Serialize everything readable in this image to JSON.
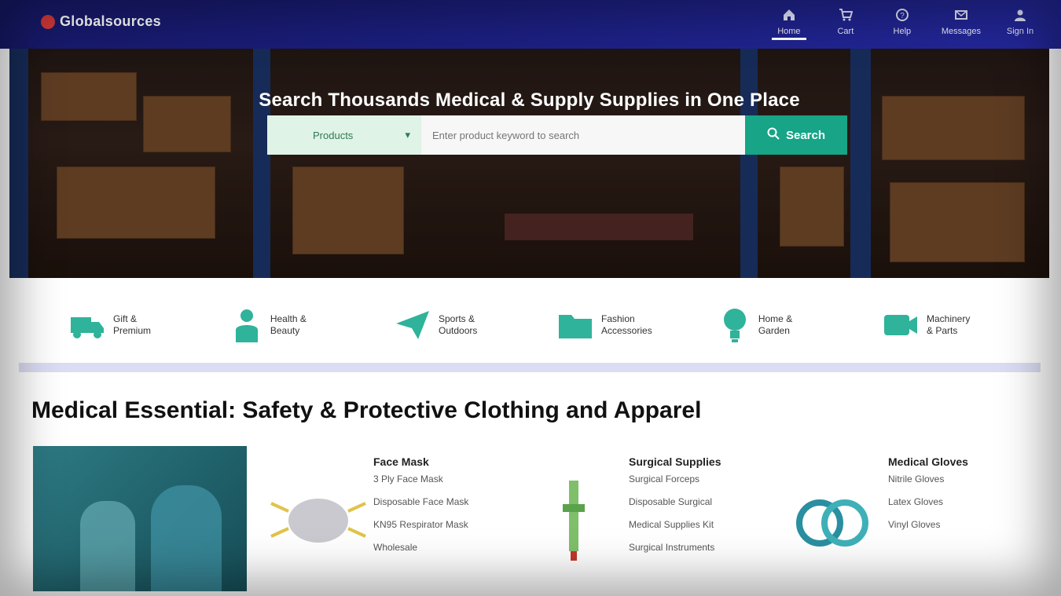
{
  "brand": {
    "name": "Globalsources",
    "logo_color": "#d63a3a"
  },
  "nav": {
    "items": [
      {
        "label": "Home",
        "icon": "home-icon"
      },
      {
        "label": "Cart",
        "icon": "cart-icon"
      },
      {
        "label": "Help",
        "icon": "help-icon"
      },
      {
        "label": "Messages",
        "icon": "message-icon"
      },
      {
        "label": "Sign In",
        "icon": "user-icon"
      }
    ]
  },
  "hero": {
    "title": "Search Thousands Medical & Supply Supplies in One Place",
    "search": {
      "category": "Products",
      "placeholder": "Enter product keyword to search",
      "button_label": "Search"
    }
  },
  "categories": [
    {
      "label": "Gift & Premium",
      "icon": "truck-icon"
    },
    {
      "label": "Health & Beauty",
      "icon": "person-icon"
    },
    {
      "label": "Sports & Outdoors",
      "icon": "plane-icon"
    },
    {
      "label": "Fashion Accessories",
      "icon": "folder-icon"
    },
    {
      "label": "Home & Garden",
      "icon": "lightbulb-icon"
    },
    {
      "label": "Machinery & Parts",
      "icon": "video-icon"
    }
  ],
  "section": {
    "title": "Medical Essential: Safety & Protective Clothing and Apparel",
    "products": [
      {
        "title": "Face Mask",
        "lines": [
          "3 Ply Face Mask",
          "Disposable Face Mask",
          "KN95 Respirator Mask",
          "Wholesale"
        ]
      },
      {
        "title": "Surgical Supplies",
        "lines": [
          "Surgical Forceps",
          "Disposable Surgical",
          "Medical Supplies Kit",
          "Surgical Instruments"
        ]
      },
      {
        "title": "Medical Gloves",
        "lines": [
          "Nitrile Gloves",
          "Latex Gloves",
          "Vinyl Gloves"
        ]
      }
    ]
  },
  "colors": {
    "nav_bg": "#1c1f80",
    "accent": "#17a487",
    "category_icon": "#2fb39a"
  }
}
